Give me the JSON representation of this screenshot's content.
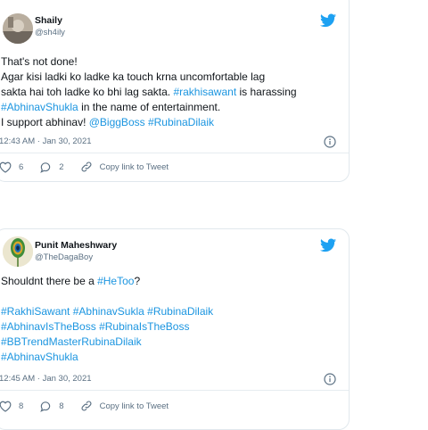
{
  "colors": {
    "link": "#1b95e0",
    "muted": "#5b7083",
    "twitter_blue": "#1da1f2",
    "border": "#e1e8ed"
  },
  "icons": [
    "twitter-bird-icon",
    "info-icon",
    "heart-icon",
    "reply-icon",
    "link-icon"
  ],
  "tweets": [
    {
      "author": "Shaily",
      "handle": "@sh4ily",
      "line1": "That's not done!",
      "line2": "Agar kisi ladki ko ladke ka touch krna uncomfortable lag",
      "line3a": "sakta hai toh ladke ko bhi lag sakta. ",
      "tag1": "#rakhisawant",
      "line3b": " is harassing",
      "tag2": "#AbhinavShukla",
      "line4b": " in the name of entertainment.",
      "line5a": "I support abhinav! ",
      "mention": "@BiggBoss",
      "tag3": "#RubinaDilaik",
      "timestamp": "12:43 AM · Jan 30, 2021",
      "likes": "6",
      "replies": "2",
      "copy_link": "Copy link to Tweet"
    },
    {
      "author": "Punit Maheshwary",
      "handle": "@TheDagaBoy",
      "line1a": "Shouldnt there be a ",
      "line1tag": "#HeToo",
      "line1b": "?",
      "tag_a": "#RakhiSawant",
      "tag_b": "#AbhinavSukla",
      "tag_c": "#RubinaDilaik",
      "tag_d": "#AbhinavIsTheBoss",
      "tag_e": "#RubinaIsTheBoss",
      "tag_f": "#BBTrendMasterRubinaDilaik",
      "tag_g": "#AbhinavShukla",
      "timestamp": "12:45 AM · Jan 30, 2021",
      "likes": "8",
      "replies": "8",
      "copy_link": "Copy link to Tweet"
    }
  ]
}
